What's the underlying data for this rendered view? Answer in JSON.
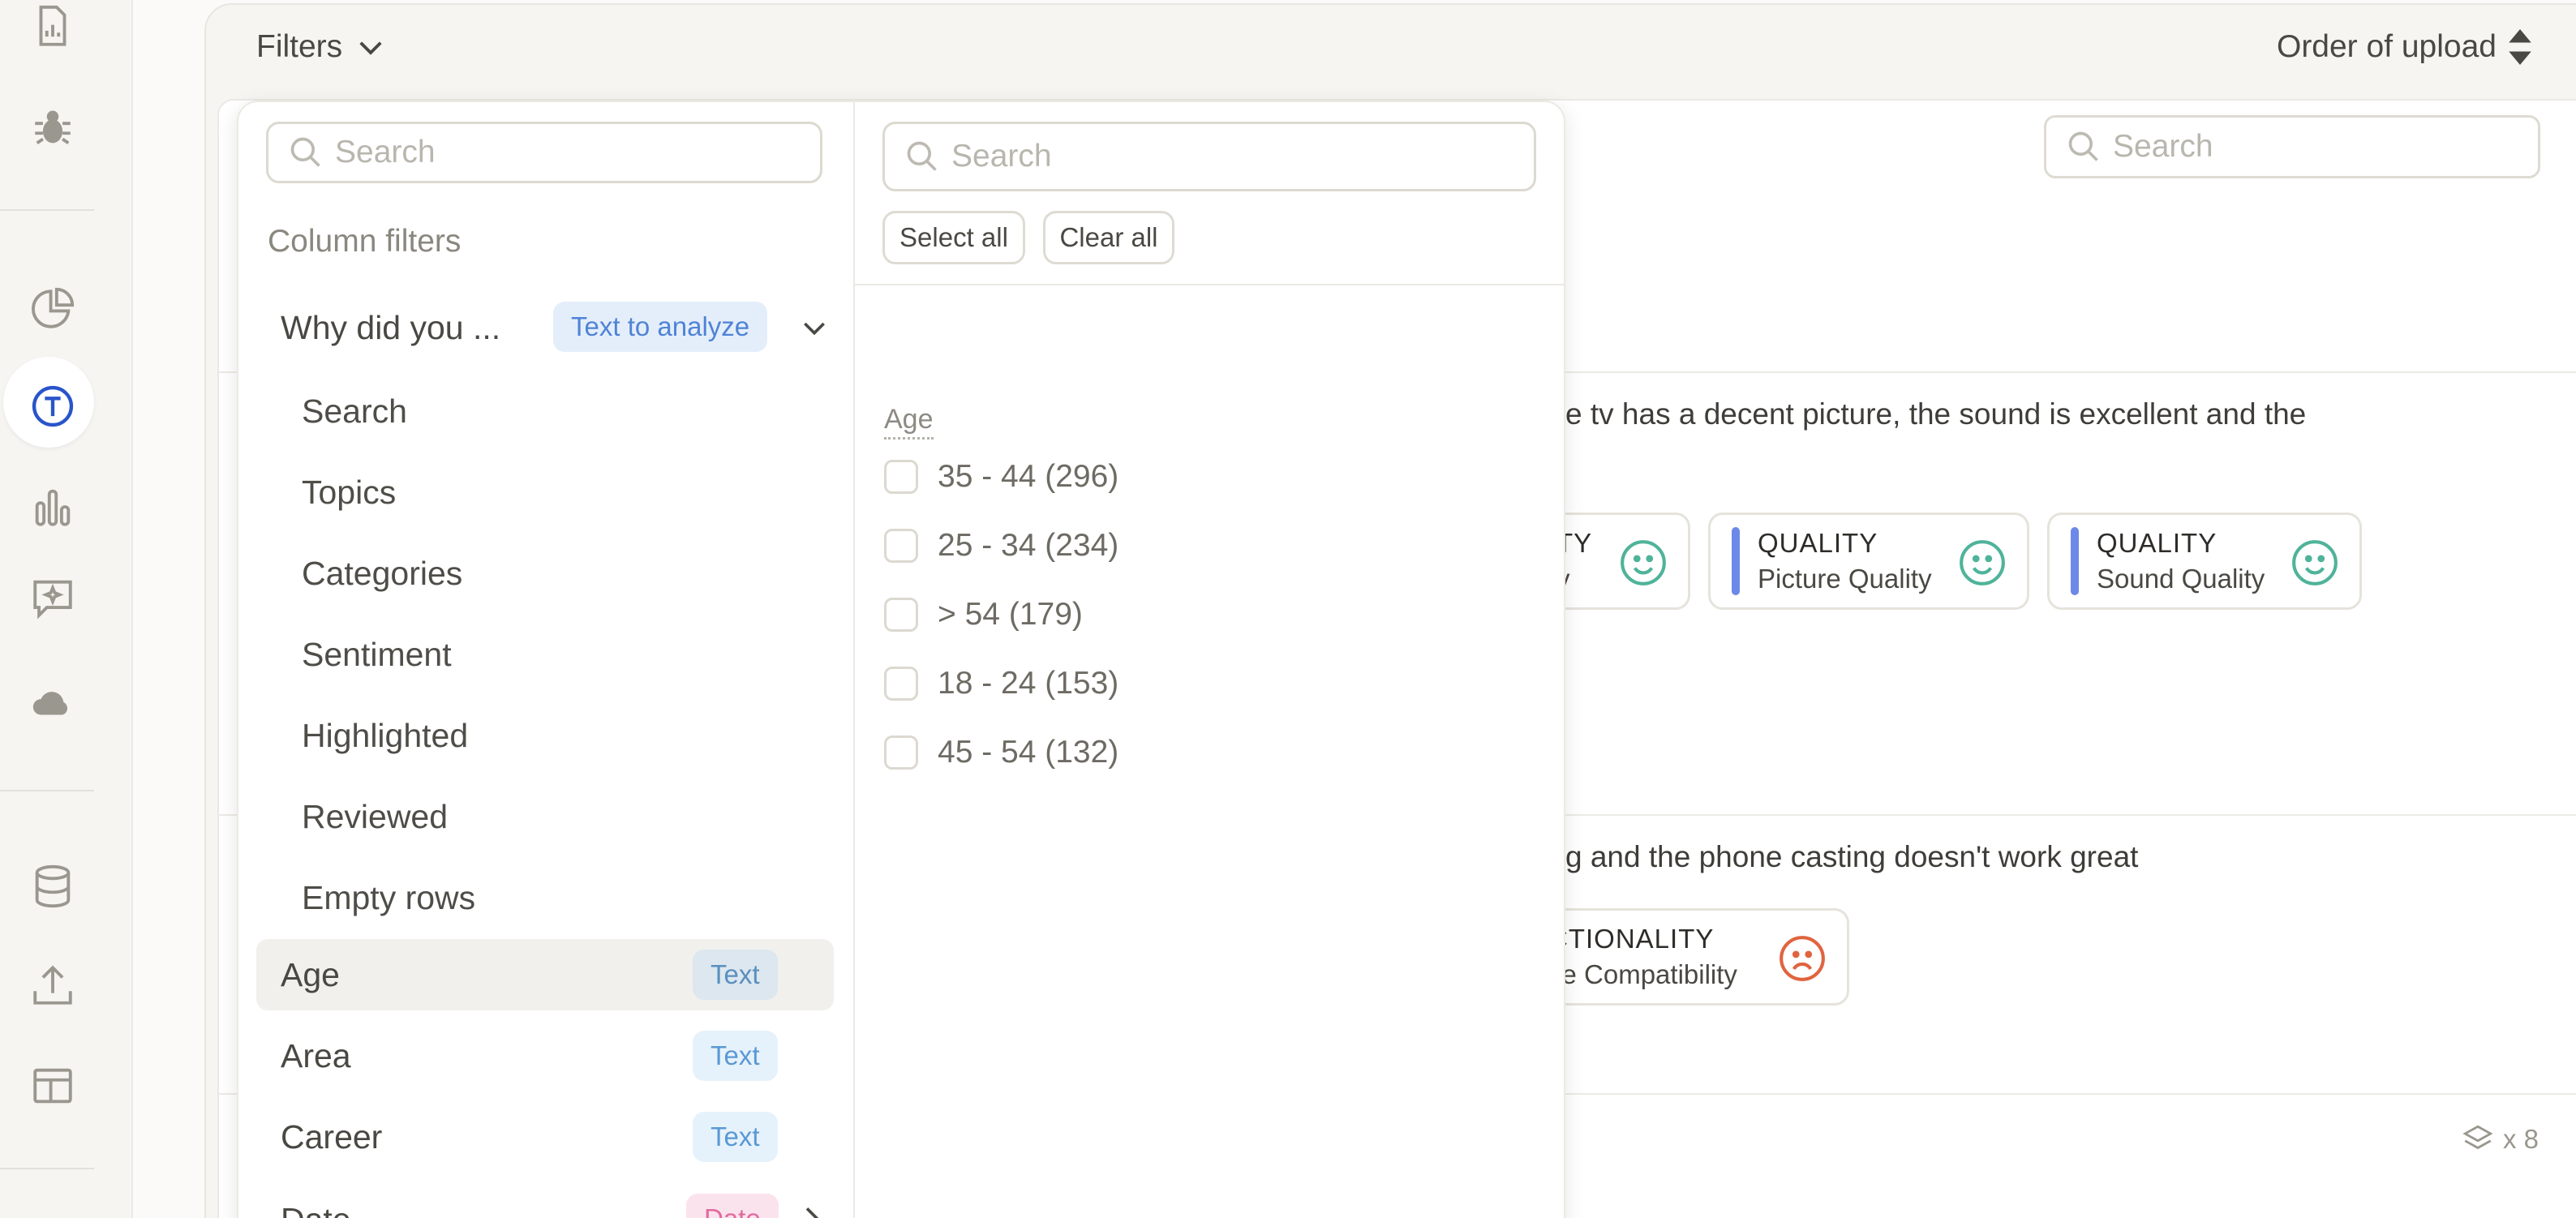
{
  "rail": {
    "icons": [
      "report-icon",
      "bug-icon",
      "pie-chart-icon",
      "text-analysis-icon",
      "bar-chart-icon",
      "sparkle-chat-icon",
      "cloud-icon",
      "database-icon",
      "upload-icon",
      "layout-icon"
    ]
  },
  "toolbar": {
    "filters_label": "Filters",
    "order_label": "Order of upload"
  },
  "content": {
    "search_placeholder": "Search",
    "row1_text": "e tv has a decent picture, the sound is excellent and the",
    "row2_text": "g and the phone casting doesn't work great",
    "row1_tags": [
      {
        "category": "TY",
        "sub": "y",
        "sentiment": "positive"
      },
      {
        "category": "QUALITY",
        "sub": "Picture Quality",
        "sentiment": "positive"
      },
      {
        "category": "QUALITY",
        "sub": "Sound Quality",
        "sentiment": "positive"
      }
    ],
    "row2_tags": [
      {
        "category": "CTIONALITY",
        "sub": "ce Compatibility",
        "sentiment": "negative"
      }
    ],
    "layers_count": "x 8",
    "colors": {
      "positive": "#4fb39a",
      "negative": "#e0643f",
      "tag_bar": "#6c88e8"
    }
  },
  "panel": {
    "left_search_placeholder": "Search",
    "column_filters_title": "Column filters",
    "why_column": {
      "label": "Why did you ...",
      "badge": "Text to analyze"
    },
    "why_subitems": [
      "Search",
      "Topics",
      "Categories",
      "Sentiment",
      "Highlighted",
      "Reviewed",
      "Empty rows"
    ],
    "columns": [
      {
        "label": "Age",
        "badge": "Text",
        "active": true
      },
      {
        "label": "Area",
        "badge": "Text"
      },
      {
        "label": "Career",
        "badge": "Text"
      },
      {
        "label": "Date",
        "badge": "Date"
      }
    ],
    "right_search_placeholder": "Search",
    "select_all": "Select all",
    "clear_all": "Clear all",
    "group_label": "Age",
    "options": [
      "35 - 44 (296)",
      "25 - 34 (234)",
      "> 54 (179)",
      "18 - 24 (153)",
      "45 - 54 (132)"
    ]
  }
}
